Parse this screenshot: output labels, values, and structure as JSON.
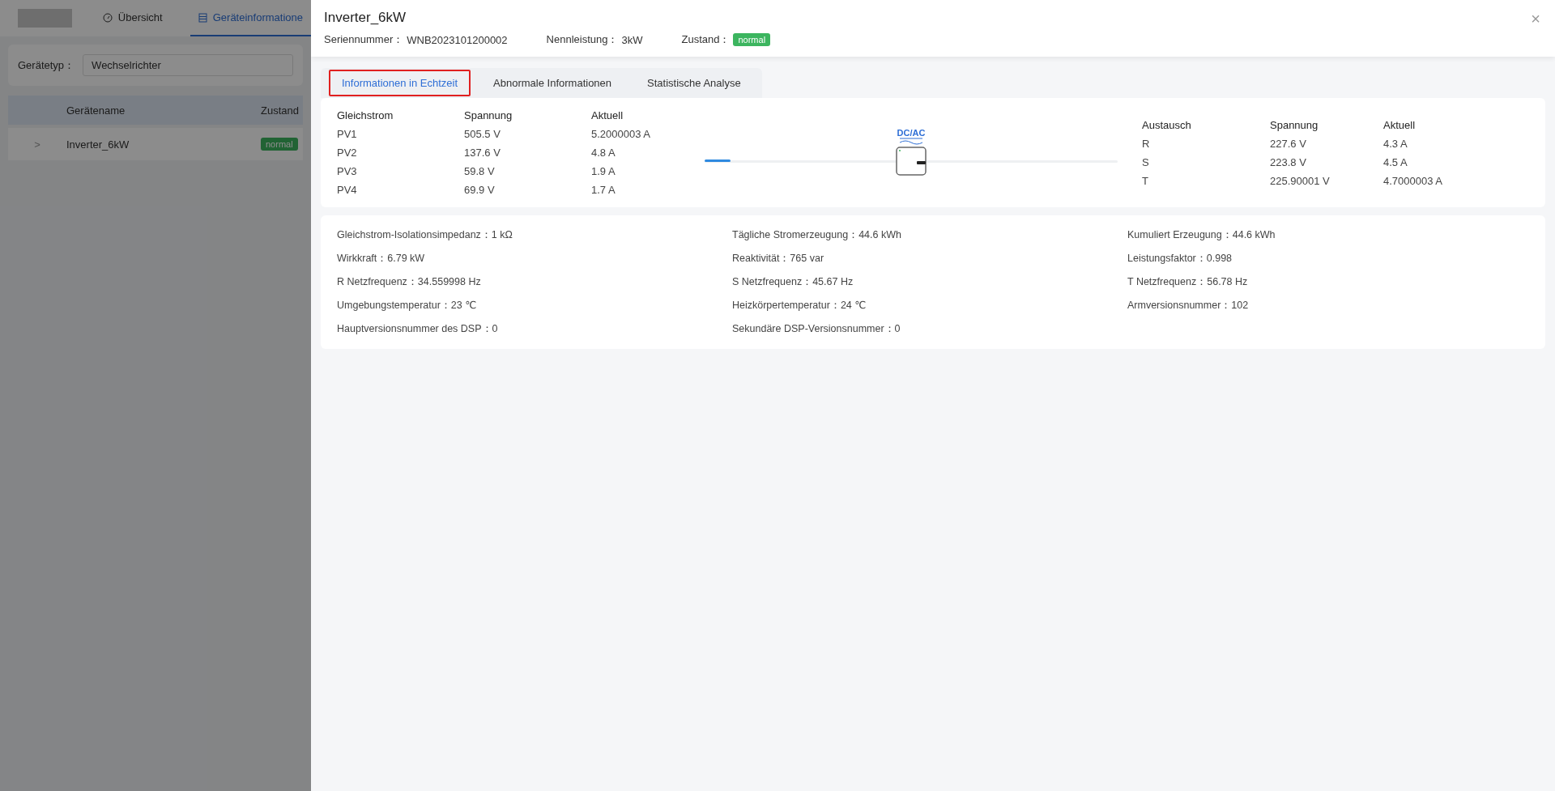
{
  "background_page": {
    "nav_tabs": [
      {
        "label": "Übersicht",
        "selected": false
      },
      {
        "label": "Geräteinformatione",
        "selected": true
      }
    ],
    "filter": {
      "label": "Gerätetyp：",
      "value": "Wechselrichter"
    },
    "table": {
      "columns": [
        "Gerätename",
        "Zustand"
      ],
      "rows": [
        {
          "expand": ">",
          "name": "Inverter_6kW",
          "status": "normal"
        }
      ]
    }
  },
  "drawer": {
    "title": "Inverter_6kW",
    "close": "×",
    "meta": [
      {
        "label": "Seriennummer：",
        "value": "WNB2023101200002",
        "kind": "text"
      },
      {
        "label": "Nennleistung：",
        "value": "3kW",
        "kind": "text"
      },
      {
        "label": "Zustand：",
        "value": "normal",
        "kind": "badge"
      }
    ],
    "tabs": [
      {
        "label": "Informationen in Echtzeit",
        "selected": true,
        "highlighted": true
      },
      {
        "label": "Abnormale Informationen",
        "selected": false,
        "highlighted": false
      },
      {
        "label": "Statistische Analyse",
        "selected": false,
        "highlighted": false
      }
    ],
    "dc_table": {
      "columns": [
        "Gleichstrom",
        "Spannung",
        "Aktuell"
      ],
      "rows": [
        [
          "PV1",
          "505.5 V",
          "5.2000003 A"
        ],
        [
          "PV2",
          "137.6 V",
          "4.8 A"
        ],
        [
          "PV3",
          "59.8 V",
          "1.9 A"
        ],
        [
          "PV4",
          "69.9 V",
          "1.7 A"
        ]
      ]
    },
    "diagram": {
      "label": "DC/AC"
    },
    "ac_table": {
      "columns": [
        "Austausch",
        "Spannung",
        "Aktuell"
      ],
      "rows": [
        [
          "R",
          "227.6 V",
          "4.3 A"
        ],
        [
          "S",
          "223.8 V",
          "4.5 A"
        ],
        [
          "T",
          "225.90001 V",
          "4.7000003 A"
        ]
      ]
    },
    "info": [
      {
        "label": "Gleichstrom-Isolationsimpedanz：",
        "value": "1 kΩ"
      },
      {
        "label": "Tägliche Stromerzeugung：",
        "value": "44.6 kWh"
      },
      {
        "label": "Kumuliert Erzeugung：",
        "value": "44.6 kWh"
      },
      {
        "label": "Wirkkraft：",
        "value": "6.79 kW"
      },
      {
        "label": "Reaktivität：",
        "value": "765 var"
      },
      {
        "label": "Leistungsfaktor：",
        "value": "0.998"
      },
      {
        "label": "R Netzfrequenz：",
        "value": "34.559998 Hz"
      },
      {
        "label": "S Netzfrequenz：",
        "value": "45.67 Hz"
      },
      {
        "label": "T Netzfrequenz：",
        "value": "56.78 Hz"
      },
      {
        "label": "Umgebungstemperatur：",
        "value": "23 ℃"
      },
      {
        "label": "Heizkörpertemperatur：",
        "value": "24 ℃"
      },
      {
        "label": "Armversionsnummer：",
        "value": "102"
      },
      {
        "label": "Hauptversionsnummer des DSP：",
        "value": "0"
      },
      {
        "label": "Sekundäre DSP-Versionsnummer：",
        "value": "0"
      }
    ]
  }
}
